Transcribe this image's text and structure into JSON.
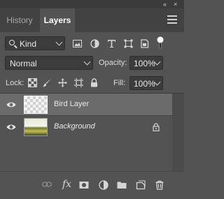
{
  "window": {
    "collapse_glyph": "«",
    "close_glyph": "×"
  },
  "tabs": [
    {
      "label": "History",
      "active": false
    },
    {
      "label": "Layers",
      "active": true
    }
  ],
  "filter": {
    "kind_label": "Kind",
    "icons": [
      "image-filter-icon",
      "adjustment-filter-icon",
      "type-filter-icon",
      "shape-filter-icon",
      "smart-object-filter-icon",
      "filter-toggle-icon"
    ]
  },
  "blend": {
    "mode": "Normal",
    "opacity_label": "Opacity:",
    "opacity_value": "100%"
  },
  "lock": {
    "label": "Lock:",
    "icons": [
      "lock-transparent-pixels-icon",
      "lock-image-pixels-icon",
      "lock-position-icon",
      "lock-artboard-icon",
      "lock-all-icon"
    ],
    "fill_label": "Fill:",
    "fill_value": "100%"
  },
  "layers": [
    {
      "name": "Bird Layer",
      "visible": true,
      "selected": true,
      "locked": false
    },
    {
      "name": "Background",
      "visible": true,
      "selected": false,
      "locked": true
    }
  ],
  "bottom_icons": [
    "link-layers-icon",
    "fx-icon",
    "add-mask-icon",
    "adjustment-layer-icon",
    "new-group-icon",
    "new-layer-icon",
    "delete-layer-icon"
  ],
  "bottom_fx_label": "fx",
  "colors": {
    "panel_bg": "#535353",
    "tab_bar_bg": "#424242",
    "field_bg": "#3c3c3c",
    "selected_row": "#6b6b6b"
  }
}
